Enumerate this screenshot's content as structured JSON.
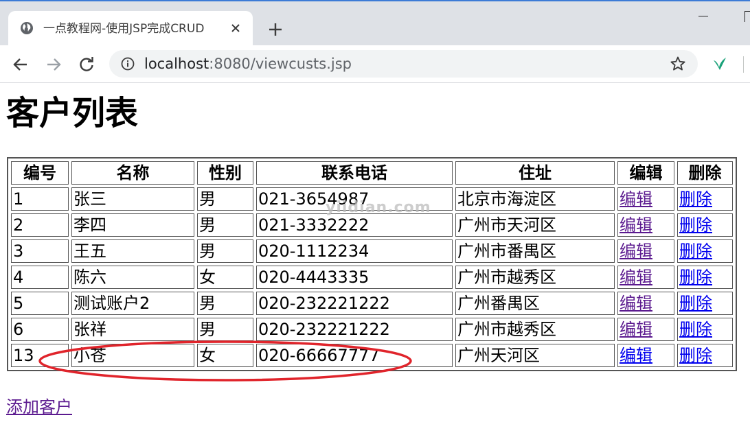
{
  "browser": {
    "tab_title": "一点教程网-使用JSP完成CRUD",
    "url_host": "localhost",
    "url_rest": ":8080/viewcusts.jsp"
  },
  "page": {
    "title": "客户列表",
    "add_link": "添加客户",
    "watermark": "yiidian.com"
  },
  "table": {
    "headers": [
      "编号",
      "名称",
      "性别",
      "联系电话",
      "住址",
      "编辑",
      "删除"
    ],
    "edit_label": "编辑",
    "delete_label": "删除",
    "rows": [
      {
        "id": "1",
        "name": "张三",
        "gender": "男",
        "phone": "021-3654987",
        "address": "北京市海淀区"
      },
      {
        "id": "2",
        "name": "李四",
        "gender": "男",
        "phone": "021-3332222",
        "address": "广州市天河区"
      },
      {
        "id": "3",
        "name": "王五",
        "gender": "男",
        "phone": "020-1112234",
        "address": "广州市番禺区"
      },
      {
        "id": "4",
        "name": "陈六",
        "gender": "女",
        "phone": "020-4443335",
        "address": "广州市越秀区"
      },
      {
        "id": "5",
        "name": "测试账户2",
        "gender": "男",
        "phone": "020-232221222",
        "address": "广州番禺区"
      },
      {
        "id": "6",
        "name": "张祥",
        "gender": "男",
        "phone": "020-232221222",
        "address": "广州市越秀区"
      },
      {
        "id": "13",
        "name": "小苍",
        "gender": "女",
        "phone": "020-66667777",
        "address": "广州天河区"
      }
    ]
  },
  "colors": {
    "tabbar_bg": "#dee1e6",
    "visited_link": "#5b1a8f",
    "link": "#0000ee",
    "annotation": "#e0242b"
  }
}
